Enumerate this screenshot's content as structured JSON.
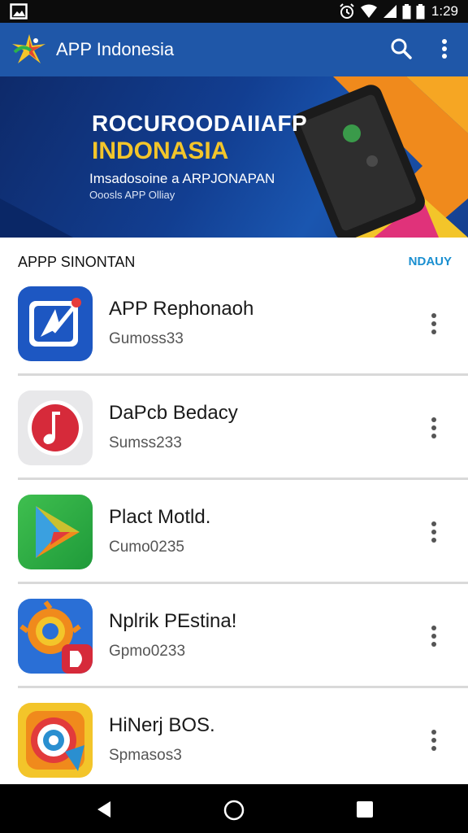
{
  "status_bar": {
    "time": "1:29",
    "icons": [
      "gallery-icon",
      "alarm-icon",
      "wifi-icon",
      "signal-icon",
      "battery-icon",
      "battery-icon"
    ]
  },
  "app_bar": {
    "title": "APP Indonesia",
    "actions": [
      "search-icon",
      "more-vert-icon"
    ],
    "color": "#1f57a8"
  },
  "banner": {
    "title_line1": "ROCUROODAIIAFP",
    "title_line2": "INDONASIA",
    "subtitle": "Imsadosoine a ARPJONAPAN",
    "caption": "Ooosls APP Olliay",
    "accent_colors": [
      "#f3c52a",
      "#f08a1c",
      "#e0327a"
    ]
  },
  "section": {
    "title": "APPP SINONTAN",
    "link": "NDAUY"
  },
  "apps": [
    {
      "name": "APP Rephonaoh",
      "sub": "Gumoss33",
      "icon": "pen-app-icon"
    },
    {
      "name": "DaPcb Bedacy",
      "sub": "Sumss233",
      "icon": "music-note-app-icon"
    },
    {
      "name": "Plact Motld.",
      "sub": "Cumo0235",
      "icon": "play-store-app-icon"
    },
    {
      "name": "Nplrik PEstina!",
      "sub": "Gpmo0233",
      "icon": "colorful-gear-app-icon"
    },
    {
      "name": "HiNerj BOS.",
      "sub": "Spmasos3",
      "icon": "camera-lens-app-icon"
    }
  ],
  "nav_bar": {
    "buttons": [
      "back-icon",
      "home-icon",
      "recents-icon"
    ]
  }
}
